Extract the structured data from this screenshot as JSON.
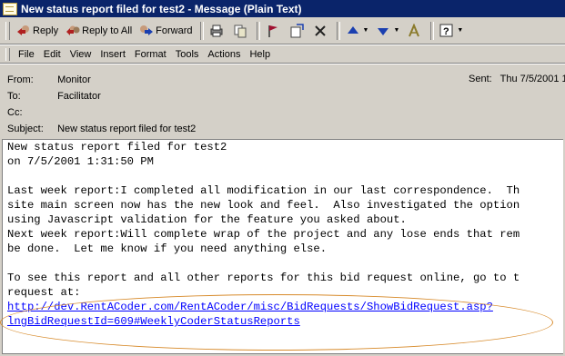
{
  "window": {
    "title": "New status report filed for test2 - Message (Plain Text)"
  },
  "toolbar": {
    "reply": "Reply",
    "reply_all": "Reply to All",
    "forward": "Forward"
  },
  "menu": [
    "File",
    "Edit",
    "View",
    "Insert",
    "Format",
    "Tools",
    "Actions",
    "Help"
  ],
  "header": {
    "from_label": "From:",
    "from_value": "Monitor",
    "to_label": "To:",
    "to_value": "Facilitator",
    "cc_label": "Cc:",
    "cc_value": "",
    "subject_label": "Subject:",
    "subject_value": "New status report filed for test2",
    "sent_label": "Sent:",
    "sent_value": "Thu 7/5/2001 1"
  },
  "body": {
    "lines": [
      "New status report filed for test2",
      "on 7/5/2001 1:31:50 PM",
      "",
      "Last week report:I completed all modification in our last correspondence.  Th",
      "site main screen now has the new look and feel.  Also investigated the option",
      "using Javascript validation for the feature you asked about.",
      "Next week report:Will complete wrap of the project and any lose ends that rem",
      "be done.  Let me know if you need anything else.",
      "",
      "To see this report and all other reports for this bid request online, go to t",
      "request at:"
    ],
    "link_line1": "http://dev.RentACoder.com/RentACoder/misc/BidRequests/ShowBidRequest.asp?",
    "link_line2": "lngBidRequestId=609#WeeklyCoderStatusReports"
  },
  "colors": {
    "titlebar": "#0a246a",
    "link": "#0000ff",
    "highlight_oval": "#d78a2a"
  }
}
